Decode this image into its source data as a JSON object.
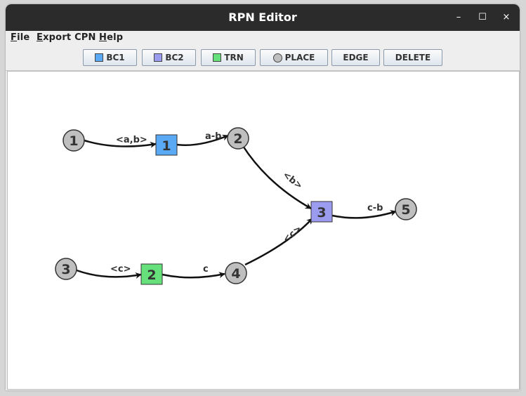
{
  "window": {
    "title": "RPN Editor",
    "controls": {
      "minimize": "–",
      "maximize": "☐",
      "close": "×"
    }
  },
  "menu": {
    "file": "File",
    "export": "Export CPN",
    "help": "Help"
  },
  "toolbar": {
    "bc1": "BC1",
    "bc2": "BC2",
    "trn": "TRN",
    "place": "PLACE",
    "edge": "EDGE",
    "delete": "DELETE",
    "bc1_color": "#5aa9f5",
    "bc2_color": "#9b9bf0",
    "trn_color": "#66e07a",
    "place_color": "#bfbfbf"
  },
  "graph": {
    "places": [
      "1",
      "2",
      "3",
      "4",
      "5"
    ],
    "transitions": [
      {
        "label": "1",
        "kind": "BC1",
        "color": "#5aa9f5"
      },
      {
        "label": "2",
        "kind": "TRN",
        "color": "#66e07a"
      },
      {
        "label": "3",
        "kind": "BC2",
        "color": "#9b9bf0"
      }
    ],
    "edges": [
      {
        "from": "place 1",
        "to": "transition 1",
        "label": "<a,b>"
      },
      {
        "from": "transition 1",
        "to": "place 2",
        "label": "a-b"
      },
      {
        "from": "place 2",
        "to": "transition 3",
        "label": "<b>"
      },
      {
        "from": "place 3",
        "to": "transition 2",
        "label": "<c>"
      },
      {
        "from": "transition 2",
        "to": "place 4",
        "label": "c"
      },
      {
        "from": "place 4",
        "to": "transition 3",
        "label": "<c>"
      },
      {
        "from": "transition 3",
        "to": "place 5",
        "label": "c-b"
      }
    ]
  }
}
